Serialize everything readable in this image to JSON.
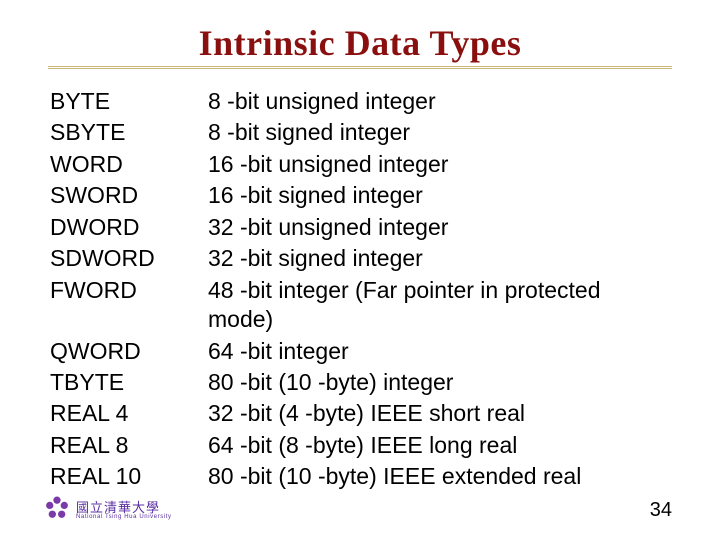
{
  "title": "Intrinsic Data Types",
  "types": {
    "r0": {
      "name": "BYTE",
      "desc": "8 -bit unsigned integer"
    },
    "r1": {
      "name": "SBYTE",
      "desc": "8 -bit signed integer"
    },
    "r2": {
      "name": "WORD",
      "desc": "16 -bit unsigned integer"
    },
    "r3": {
      "name": "SWORD",
      "desc": "16 -bit signed integer"
    },
    "r4": {
      "name": "DWORD",
      "desc": "32 -bit unsigned integer"
    },
    "r5": {
      "name": "SDWORD",
      "desc": "32 -bit signed integer"
    },
    "r6": {
      "name": "FWORD",
      "desc": "48 -bit integer (Far pointer in protected mode)"
    },
    "r7": {
      "name": "QWORD",
      "desc": "64 -bit integer"
    },
    "r8": {
      "name": "TBYTE",
      "desc": "80 -bit (10 -byte) integer"
    },
    "r9": {
      "name": "REAL 4",
      "desc": "32 -bit (4 -byte) IEEE short real"
    },
    "r10": {
      "name": "REAL 8",
      "desc": "64 -bit (8 -byte) IEEE long real"
    },
    "r11": {
      "name": "REAL 10",
      "desc": "80 -bit (10 -byte) IEEE extended real"
    }
  },
  "footer": {
    "uni_zh": "國立清華大學",
    "uni_en": "National Tsing Hua University",
    "page": "34"
  }
}
